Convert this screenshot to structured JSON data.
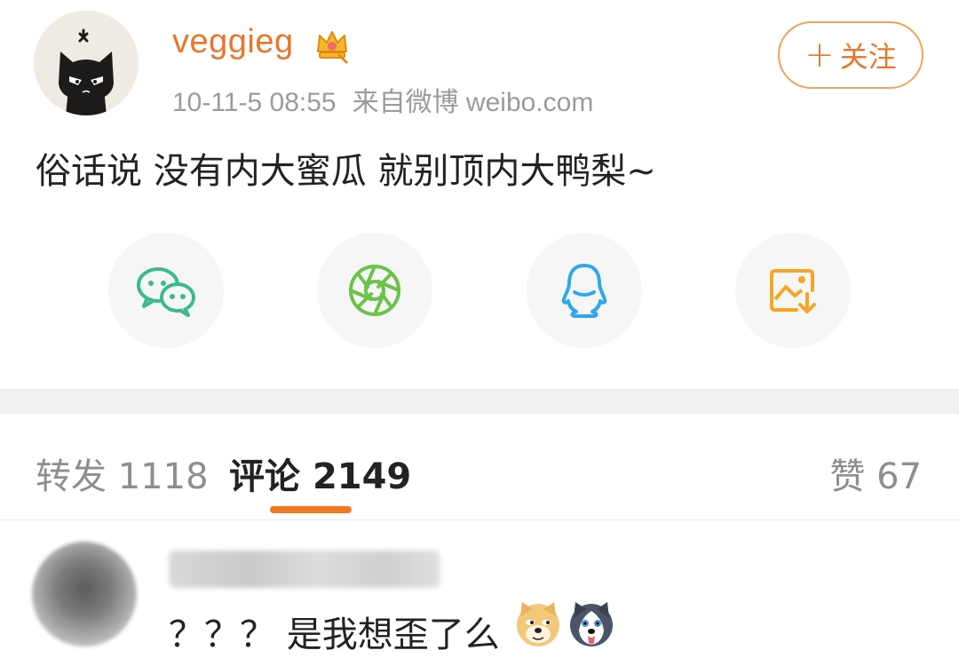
{
  "post": {
    "username": "veggieg",
    "timestamp": "10-11-5 08:55",
    "source": "来自微博 weibo.com",
    "follow_label": "关注",
    "follow_plus": "+",
    "content": "俗话说 没有内大蜜瓜 就别顶内大鸭梨~",
    "share_icons": [
      "wechat-icon",
      "moments-icon",
      "qq-icon",
      "save-image-icon"
    ]
  },
  "tabs": {
    "repost_label": "转发",
    "repost_count": "1118",
    "comment_label": "评论",
    "comment_count": "2149",
    "like_label": "赞",
    "like_count": "67"
  },
  "comment": {
    "text": "？？？ 是我想歪了么",
    "emojis": [
      "doge-emoji",
      "husky-emoji"
    ]
  },
  "colors": {
    "accent": "#e8762d",
    "tab_indicator": "#f07a22",
    "wechat": "#3cba8a",
    "moments": "#6cc24a",
    "qq": "#2ea8e8",
    "save": "#f5a623"
  }
}
